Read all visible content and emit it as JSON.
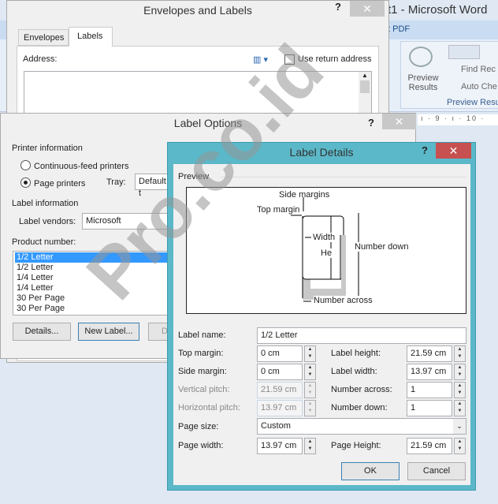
{
  "word": {
    "title": "t1 - Microsoft Word",
    "ribbon_tab": "t PDF",
    "preview_results": "Preview Results",
    "find_recipient": "Find Rec",
    "auto_check": "Auto Che",
    "group_label": "Preview Resu",
    "ruler": "ı · 9 · ı · 10 ·"
  },
  "envelopes": {
    "title": "Envelopes and Labels",
    "help": "?",
    "close": "✕",
    "tabs": [
      "Envelopes",
      "Labels"
    ],
    "address_label": "Address:",
    "use_return": "Use return address",
    "use_return_checked": false
  },
  "label_options": {
    "title": "Label Options",
    "help": "?",
    "close": "✕",
    "printer_info": "Printer information",
    "continuous": "Continuous-feed printers",
    "page_printers": "Page printers",
    "selected_printer": "Page printers",
    "tray_label": "Tray:",
    "tray_value": "Default t",
    "label_info": "Label information",
    "vendors_label": "Label vendors:",
    "vendors_value": "Microsoft",
    "product_label": "Product number:",
    "products": [
      "1/2 Letter",
      "1/2 Letter",
      "1/4 Letter",
      "1/4 Letter",
      "30 Per Page",
      "30 Per Page"
    ],
    "selected_index": 0,
    "details_btn": "Details...",
    "new_label_btn": "New Label...",
    "delete_btn": "D"
  },
  "label_details": {
    "title": "Label Details",
    "help": "?",
    "close": "✕",
    "preview_label": "Preview",
    "diagram": {
      "side_margins": "Side margins",
      "top_margin": "Top margin",
      "width": "Width",
      "height": "Height",
      "number_down": "Number down",
      "number_across": "Number across"
    },
    "label_name_label": "Label name:",
    "label_name": "1/2 Letter",
    "top_margin_label": "Top margin:",
    "top_margin": "0 cm",
    "side_margin_label": "Side margin:",
    "side_margin": "0 cm",
    "vertical_pitch_label": "Vertical pitch:",
    "vertical_pitch": "21.59 cm",
    "horizontal_pitch_label": "Horizontal pitch:",
    "horizontal_pitch": "13.97 cm",
    "page_size_label": "Page size:",
    "page_size": "Custom",
    "page_width_label": "Page width:",
    "page_width": "13.97 cm",
    "label_height_label": "Label height:",
    "label_height": "21.59 cm",
    "label_width_label": "Label width:",
    "label_width": "13.97 cm",
    "number_across_label": "Number across:",
    "number_across": "1",
    "number_down_label": "Number down:",
    "number_down": "1",
    "page_height_label": "Page Height:",
    "page_height": "21.59 cm",
    "ok": "OK",
    "cancel": "Cancel"
  },
  "watermark": "Pro.co.id"
}
